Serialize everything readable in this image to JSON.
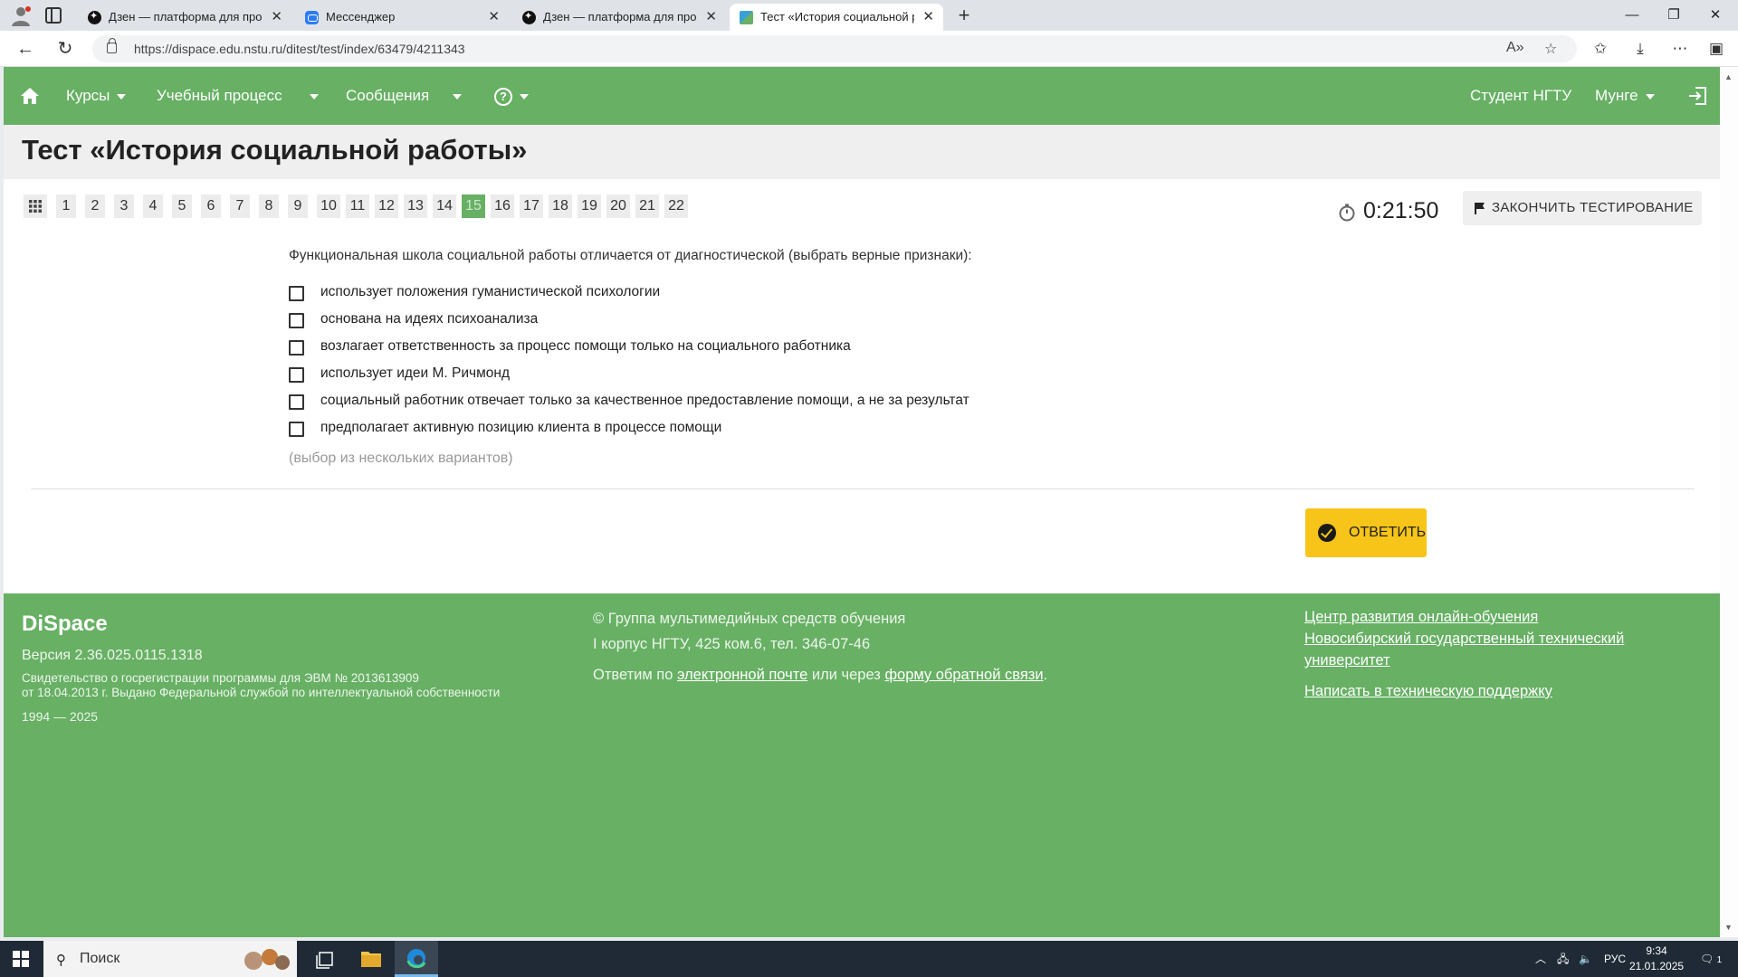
{
  "browser": {
    "tabs": [
      {
        "title": "Дзен — платформа для просмотра",
        "favicon": "zen-icon",
        "active": false
      },
      {
        "title": "Мессенджер",
        "favicon": "messenger-icon",
        "active": false
      },
      {
        "title": "Дзен — платформа для просмотра",
        "favicon": "zen-icon",
        "active": false
      },
      {
        "title": "Тест «История социальной работы»",
        "favicon": "dispace-icon",
        "active": true
      }
    ],
    "url": "https://dispace.edu.nstu.ru/ditest/test/index/63479/4211343"
  },
  "topnav": {
    "items": [
      {
        "label": "Курсы"
      },
      {
        "label": "Учебный процесс"
      },
      {
        "label": "Сообщения"
      }
    ],
    "help_label": "?",
    "user_role": "Студент НГТУ",
    "user_name": "Мунге"
  },
  "page": {
    "title": "Тест «История социальной работы»"
  },
  "question_nav": {
    "numbers": [
      "1",
      "2",
      "3",
      "4",
      "5",
      "6",
      "7",
      "8",
      "9",
      "10",
      "11",
      "12",
      "13",
      "14",
      "15",
      "16",
      "17",
      "18",
      "19",
      "20",
      "21",
      "22"
    ],
    "current": "15"
  },
  "timer": {
    "time": "0:21:50"
  },
  "finish_button": {
    "label": "ЗАКОНЧИТЬ ТЕСТИРОВАНИЕ"
  },
  "question": {
    "text": "Функциональная школа социальной работы отличается от диагностической (выбрать верные признаки):",
    "options": [
      {
        "text": "использует положения гуманистической психологии",
        "checked": false
      },
      {
        "text": "основана на идеях психоанализа",
        "checked": false
      },
      {
        "text": "возлагает ответственность за процесс помощи только на социального работника",
        "checked": false
      },
      {
        "text": "использует идеи М. Ричмонд",
        "checked": false
      },
      {
        "text": "социальный работник отвечает только за качественное предоставление помощи, а не за результат",
        "checked": false
      },
      {
        "text": "предполагает активную позицию клиента в процессе помощи",
        "checked": false
      }
    ],
    "hint": "(выбор из нескольких вариантов)"
  },
  "answer_button": {
    "label": "ОТВЕТИТЬ"
  },
  "footer": {
    "brand": "DiSpace",
    "version": "Версия 2.36.025.0115.1318",
    "cert_line1": "Свидетельство о госрегистрации программы для ЭВМ № 2013613909",
    "cert_line2": "от 18.04.2013 г. Выдано Федеральной службой по интеллектуальной собственности",
    "years": "1994 — 2025",
    "group": "© Группа мультимедийных средств обучения",
    "address": "I корпус НГТУ, 425 ком.6, тел. 346-07-46",
    "contact_prefix": "Ответим по ",
    "email_link": "электронной почте",
    "contact_mid": " или через ",
    "form_link": "форму обратной связи",
    "contact_suffix": ".",
    "links": [
      "Центр развития онлайн-обучения",
      "Новосибирский государственный технический",
      "университет",
      "Написать в техническую поддержку"
    ]
  },
  "taskbar": {
    "search_placeholder": "Поиск",
    "lang": "РУС",
    "time": "9:34",
    "date": "21.01.2025",
    "notifications": "1"
  },
  "colors": {
    "brand_green": "#67b064",
    "answer_yellow": "#f7c519",
    "current_question": "#67b064"
  }
}
